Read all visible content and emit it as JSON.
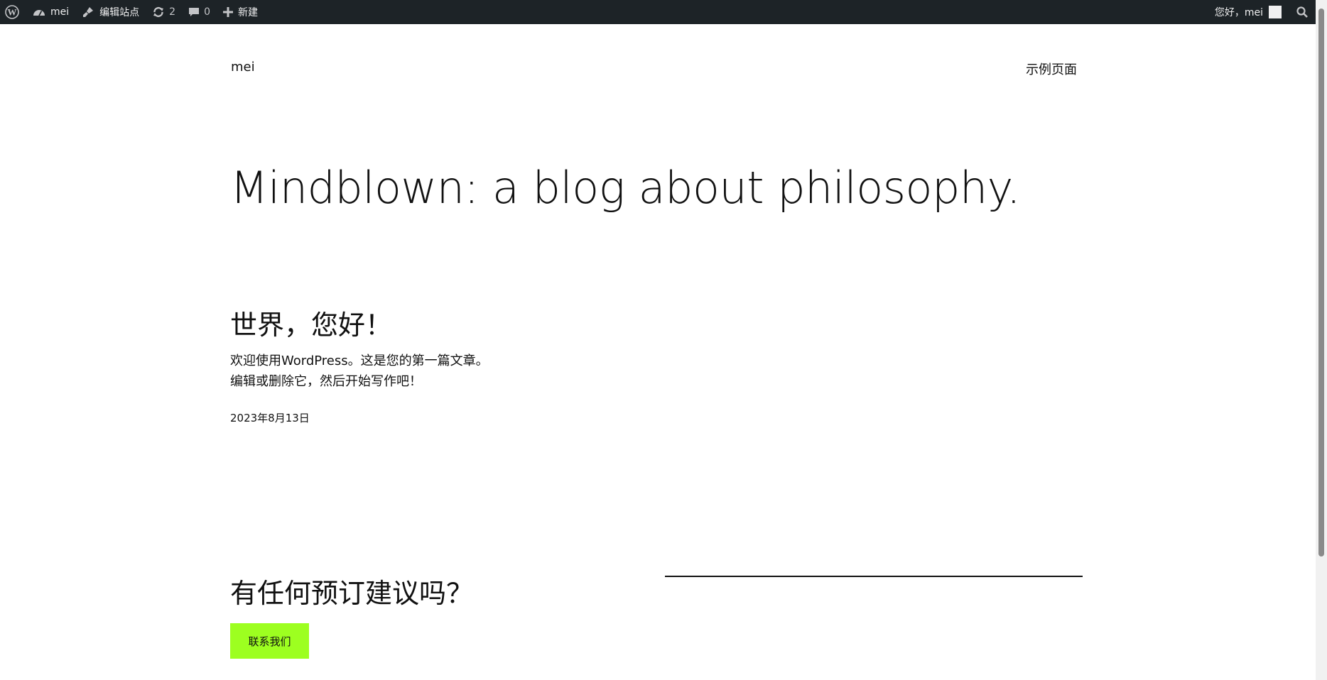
{
  "adminbar": {
    "site_name": "mei",
    "customize_label": "编辑站点",
    "updates_count": "2",
    "comments_count": "0",
    "new_label": "新建",
    "greeting": "您好，mei"
  },
  "site": {
    "title": "mei",
    "nav_item": "示例页面"
  },
  "hero": {
    "heading": "Mindblown: a blog about philosophy."
  },
  "post": {
    "title": "世界，您好！",
    "excerpt": "欢迎使用WordPress。这是您的第一篇文章。编辑或删除它，然后开始写作吧！",
    "date": "2023年8月13日"
  },
  "cta": {
    "heading": "有任何预订建议吗？",
    "button_label": "联系我们",
    "button_color": "#9dff20"
  },
  "colors": {
    "adminbar_bg": "#1d2327",
    "text": "#111111"
  }
}
